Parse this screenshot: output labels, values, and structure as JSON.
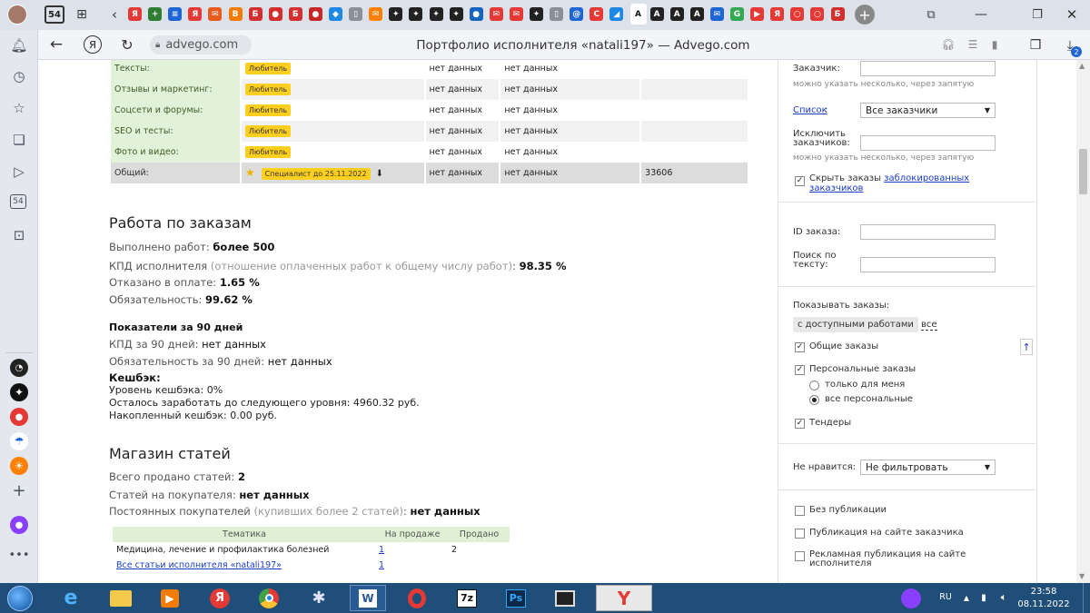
{
  "browser": {
    "tab_count": "54",
    "page_title": "Портфолио исполнителя «natali197» — Advego.com",
    "url": "advego.com",
    "downloads_badge": "2",
    "tab_icons": [
      {
        "name": "yandex-tab",
        "glyph": "Я",
        "color": "#e53935"
      },
      {
        "name": "green-tab",
        "glyph": "+",
        "color": "#2e7d32"
      },
      {
        "name": "docs-tab",
        "glyph": "≡",
        "color": "#1e66d6"
      },
      {
        "name": "yandex-tab-2",
        "glyph": "Я",
        "color": "#e53935"
      },
      {
        "name": "mail-tab",
        "glyph": "✉",
        "color": "#e95b1d"
      },
      {
        "name": "blog-tab",
        "glyph": "B",
        "color": "#f57c00"
      },
      {
        "name": "b-tab",
        "glyph": "Б",
        "color": "#d32f2f"
      },
      {
        "name": "pokeball-tab",
        "glyph": "●",
        "color": "#d32f2f"
      },
      {
        "name": "b-tab-2",
        "glyph": "Б",
        "color": "#d32f2f"
      },
      {
        "name": "ball-tab",
        "glyph": "●",
        "color": "#c62828"
      },
      {
        "name": "drop-tab",
        "glyph": "◆",
        "color": "#1e88e5"
      },
      {
        "name": "doc-tab",
        "glyph": "▯",
        "color": "#8a8f99"
      },
      {
        "name": "chat-tab",
        "glyph": "✉",
        "color": "#ff7f00"
      },
      {
        "name": "star-tab",
        "glyph": "✦",
        "color": "#222"
      },
      {
        "name": "star-tab-2",
        "glyph": "✦",
        "color": "#222"
      },
      {
        "name": "star-tab-3",
        "glyph": "✦",
        "color": "#222"
      },
      {
        "name": "star-tab-4",
        "glyph": "✦",
        "color": "#222"
      },
      {
        "name": "circle-tab",
        "glyph": "●",
        "color": "#1565c0"
      },
      {
        "name": "mail-tab-2",
        "glyph": "✉",
        "color": "#e53935"
      },
      {
        "name": "mail-tab-3",
        "glyph": "✉",
        "color": "#e53935"
      },
      {
        "name": "star-tab-5",
        "glyph": "✦",
        "color": "#222"
      },
      {
        "name": "doc-tab-2",
        "glyph": "▯",
        "color": "#8a8f99"
      },
      {
        "name": "at-tab",
        "glyph": "@",
        "color": "#1e66d6"
      },
      {
        "name": "c-tab",
        "glyph": "C",
        "color": "#e53935"
      },
      {
        "name": "zen-tab",
        "glyph": "◢",
        "color": "#1e88e5"
      },
      {
        "name": "a-tab-active",
        "glyph": "A",
        "color": "#222"
      },
      {
        "name": "a-tab",
        "glyph": "A",
        "color": "#222"
      },
      {
        "name": "a-tab-2",
        "glyph": "A",
        "color": "#222"
      },
      {
        "name": "a-tab-3",
        "glyph": "A",
        "color": "#222"
      },
      {
        "name": "mail-tab-4",
        "glyph": "✉",
        "color": "#1e66d6"
      },
      {
        "name": "g-tab",
        "glyph": "G",
        "color": "#34a853"
      },
      {
        "name": "youtube-tab",
        "glyph": "▶",
        "color": "#e53935"
      },
      {
        "name": "yandex-tab-3",
        "glyph": "Я",
        "color": "#e53935"
      },
      {
        "name": "vodafone-tab",
        "glyph": "○",
        "color": "#e53935"
      },
      {
        "name": "vodafone-tab-2",
        "glyph": "○",
        "color": "#e53935"
      },
      {
        "name": "b-tab-3",
        "glyph": "Б",
        "color": "#d32f2f"
      }
    ]
  },
  "stats_rows": [
    {
      "label": "Тексты:",
      "level": "Любитель",
      "c1": "нет данных",
      "c2": "нет данных",
      "c3": "",
      "shade": false
    },
    {
      "label": "Отзывы и маркетинг:",
      "level": "Любитель",
      "c1": "нет данных",
      "c2": "нет данных",
      "c3": "",
      "shade": true
    },
    {
      "label": "Соцсети и форумы:",
      "level": "Любитель",
      "c1": "нет данных",
      "c2": "нет данных",
      "c3": "",
      "shade": false
    },
    {
      "label": "SEO и тесты:",
      "level": "Любитель",
      "c1": "нет данных",
      "c2": "нет данных",
      "c3": "",
      "shade": true
    },
    {
      "label": "Фото и видео:",
      "level": "Любитель",
      "c1": "нет данных",
      "c2": "нет данных",
      "c3": "",
      "shade": false
    },
    {
      "label": "Общий:",
      "level": "Специалист до 25.11.2022",
      "c1": "нет данных",
      "c2": "нет данных",
      "c3": "33606",
      "shade": "total"
    }
  ],
  "orders": {
    "title": "Работа по заказам",
    "done_label": "Выполнено работ:",
    "done_value": "более 500",
    "kpd_label": "КПД исполнителя",
    "kpd_note": "(отношение оплаченных работ к общему числу работ)",
    "kpd_value": "98.35 %",
    "refused_label": "Отказано в оплате:",
    "refused_value": "1.65 %",
    "oblig_label": "Обязательность:",
    "oblig_value": "99.62 %",
    "days_title": "Показатели за 90 дней",
    "kpd90_label": "КПД за 90 дней:",
    "kpd90_value": "нет данных",
    "oblig90_label": "Обязательность за 90 дней:",
    "oblig90_value": "нет данных",
    "cashback_title": "Кешбэк:",
    "cashback_level": "Уровень кешбэка: 0%",
    "cashback_left": "Осталось заработать до следующего уровня: 4960.32 руб.",
    "cashback_total": "Накопленный кешбэк: 0.00 руб."
  },
  "shop": {
    "title": "Магазин статей",
    "sold_label": "Всего продано статей:",
    "sold_value": "2",
    "per_buyer_label": "Статей на покупателя:",
    "per_buyer_value": "нет данных",
    "regular_label": "Постоянных покупателей",
    "regular_note": "(купивших более 2 статей)",
    "regular_value": "нет данных",
    "table_headers": [
      "Тематика",
      "На продаже",
      "Продано"
    ],
    "table_rows": [
      {
        "topic": "Медицина, лечение и профилактика болезней",
        "on_sale": "1",
        "sold": "2"
      },
      {
        "topic": "Все статьи исполнителя «natali197»",
        "on_sale": "1",
        "sold": ""
      }
    ]
  },
  "filters": {
    "customer_label": "Заказчик:",
    "customer_hint": "можно указать несколько, через запятую",
    "list_label": "Список",
    "list_value": "Все заказчики",
    "exclude_label_1": "Исключить",
    "exclude_label_2": "заказчиков:",
    "exclude_hint": "можно указать несколько, через запятую",
    "hide_blocked_prefix": "Скрыть заказы ",
    "hide_blocked_link_1": "заблокированных",
    "hide_blocked_link_2": "заказчиков",
    "order_id_label": "ID заказа:",
    "search_label_1": "Поиск по",
    "search_label_2": "тексту:",
    "show_orders_label": "Показывать заказы:",
    "available_btn": "с доступными работами",
    "all_btn": "все",
    "common_orders": "Общие заказы",
    "personal_orders": "Персональные заказы",
    "only_for_me": "только для меня",
    "all_personal": "все персональные",
    "tenders": "Тендеры",
    "dislike_label": "Не нравится:",
    "dislike_value": "Не фильтровать",
    "no_publication": "Без публикации",
    "publication_site": "Публикация на сайте заказчика",
    "ad_publication_1": "Рекламная публикация на сайте",
    "ad_publication_2": "исполнителя"
  },
  "taskbar": {
    "lang": "RU",
    "time": "23:58",
    "date": "08.11.2022"
  }
}
